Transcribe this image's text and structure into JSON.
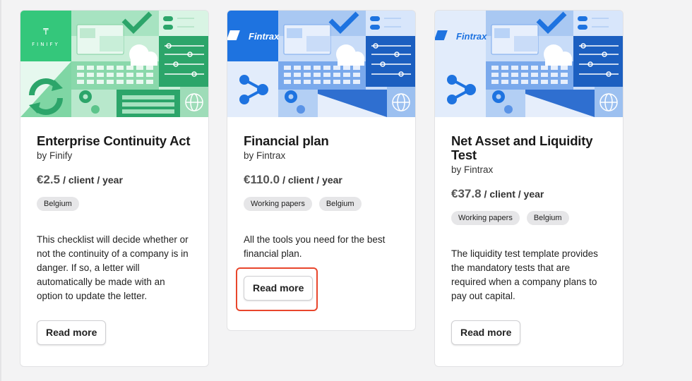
{
  "cards": [
    {
      "title": "Enterprise Continuity Act",
      "by": "by Finify",
      "price": "€2.5",
      "period": "/ client / year",
      "tags": [
        "Belgium"
      ],
      "description": "This checklist will decide whether or not the continuity of a company is in danger. If so, a letter will automatically be made with an option to update the letter.",
      "button": "Read more",
      "brand": "FINIFY",
      "theme": "#3ec97a"
    },
    {
      "title": "Financial plan",
      "by": "by Fintrax",
      "price": "€110.0",
      "period": "/ client / year",
      "tags": [
        "Working papers",
        "Belgium"
      ],
      "description": "All the tools you need for the best financial plan.",
      "button": "Read more",
      "brand": "Fintrax",
      "theme": "#1e73e0"
    },
    {
      "title": "Net Asset and Liquidity Test",
      "by": "by Fintrax",
      "price": "€37.8",
      "period": "/ client / year",
      "tags": [
        "Working papers",
        "Belgium"
      ],
      "description": "The liquidity test template provides the mandatory tests that are required when a company plans to pay out capital.",
      "button": "Read more",
      "brand": "Fintrax",
      "theme": "#1e73e0"
    }
  ],
  "colors": {
    "highlight": "#e8462c",
    "green_light": "#bfeacf",
    "blue_light": "#b9d3f7"
  }
}
